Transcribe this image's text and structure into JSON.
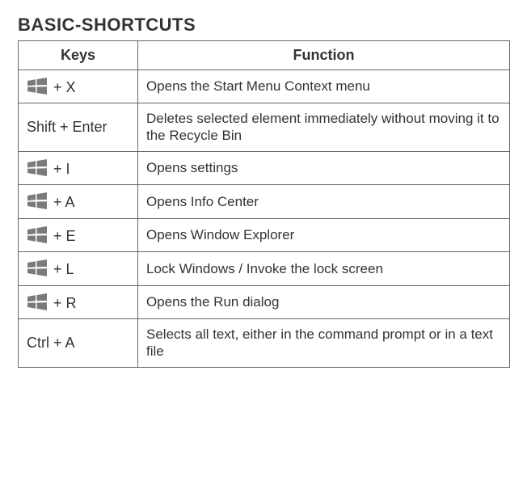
{
  "title": "BASIC-SHORTCUTS",
  "headers": {
    "keys": "Keys",
    "function": "Function"
  },
  "rows": [
    {
      "icon": "win",
      "keytext": "+ X",
      "func": "Opens the Start Menu Context menu"
    },
    {
      "icon": null,
      "keytext": "Shift + Enter",
      "func": "Deletes selected element immediately without mo­ving it to the Recycle Bin"
    },
    {
      "icon": "win",
      "keytext": "+ I",
      "func": "Opens settings"
    },
    {
      "icon": "win",
      "keytext": "+ A",
      "func": "Opens Info Center"
    },
    {
      "icon": "win",
      "keytext": "+ E",
      "func": "Opens Window Explorer"
    },
    {
      "icon": "win",
      "keytext": "+ L",
      "func": "Lock Windows / Invoke the lock screen"
    },
    {
      "icon": "win",
      "keytext": "+ R",
      "func": "Opens the Run dialog"
    },
    {
      "icon": null,
      "keytext": "Ctrl + A",
      "func": "Selects all text, either in the command prompt or in a text file"
    }
  ]
}
